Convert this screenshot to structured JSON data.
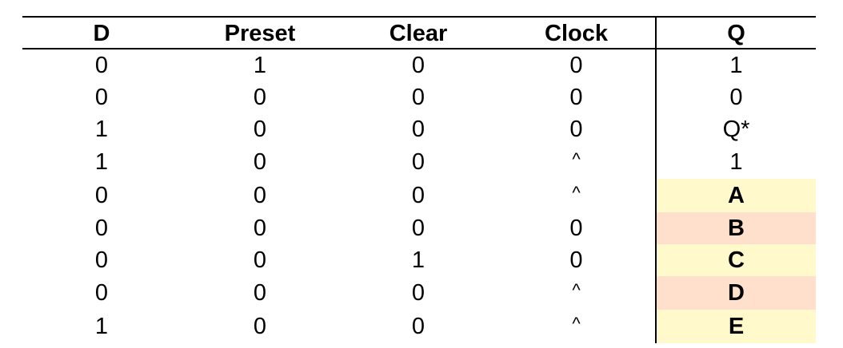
{
  "table": {
    "headers": [
      "D",
      "Preset",
      "Clear",
      "Clock",
      "Q"
    ],
    "rows": [
      {
        "d": "0",
        "preset": "1",
        "clear": "0",
        "clock": "0",
        "q": "1",
        "q_answer": false,
        "q_bg": ""
      },
      {
        "d": "0",
        "preset": "0",
        "clear": "0",
        "clock": "0",
        "q": "0",
        "q_answer": false,
        "q_bg": ""
      },
      {
        "d": "1",
        "preset": "0",
        "clear": "0",
        "clock": "0",
        "q": "Q*",
        "q_answer": false,
        "q_bg": ""
      },
      {
        "d": "1",
        "preset": "0",
        "clear": "0",
        "clock": "^",
        "q": "1",
        "q_answer": false,
        "q_bg": ""
      },
      {
        "d": "0",
        "preset": "0",
        "clear": "0",
        "clock": "^",
        "q": "A",
        "q_answer": true,
        "q_bg": "#fff9cc"
      },
      {
        "d": "0",
        "preset": "0",
        "clear": "0",
        "clock": "0",
        "q": "B",
        "q_answer": true,
        "q_bg": "#ffe0cc"
      },
      {
        "d": "0",
        "preset": "0",
        "clear": "1",
        "clock": "0",
        "q": "C",
        "q_answer": true,
        "q_bg": "#fff9cc"
      },
      {
        "d": "0",
        "preset": "0",
        "clear": "0",
        "clock": "^",
        "q": "D",
        "q_answer": true,
        "q_bg": "#ffe0cc"
      },
      {
        "d": "1",
        "preset": "0",
        "clear": "0",
        "clock": "^",
        "q": "E",
        "q_answer": true,
        "q_bg": "#fff9cc"
      }
    ]
  },
  "colors": {
    "answer_yellow": "#fff9cc",
    "answer_peach": "#ffe0cc",
    "rule": "#000000"
  }
}
